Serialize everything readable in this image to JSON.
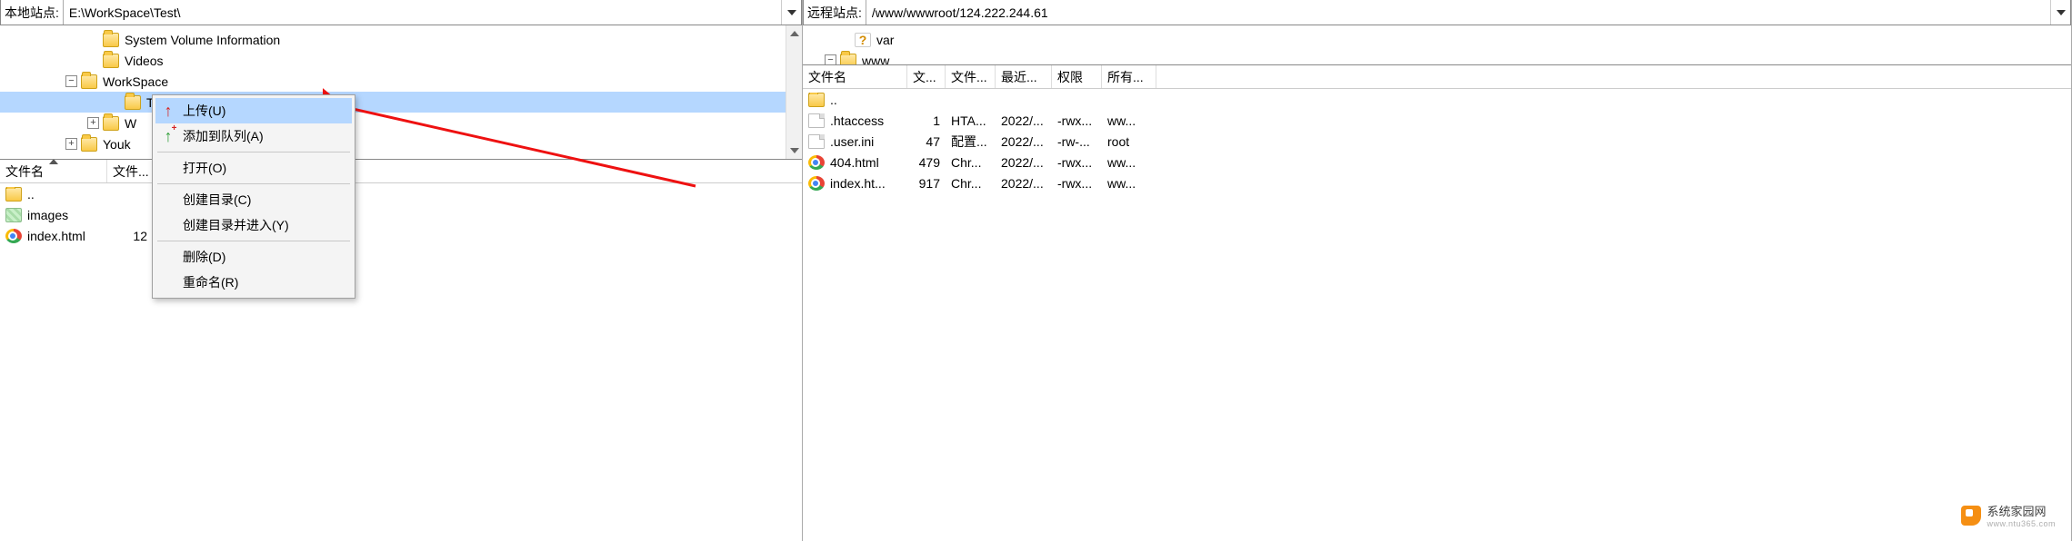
{
  "local": {
    "label": "本地站点:",
    "path": "E:\\WorkSpace\\Test\\",
    "tree": [
      {
        "indent": 96,
        "exp": "",
        "icon": "folder",
        "label": "System Volume Information",
        "sel": false
      },
      {
        "indent": 96,
        "exp": "",
        "icon": "folder",
        "label": "Videos",
        "sel": false
      },
      {
        "indent": 72,
        "exp": "−",
        "icon": "folder",
        "label": "WorkSpace",
        "sel": false
      },
      {
        "indent": 120,
        "exp": "",
        "icon": "folder",
        "label": "Te",
        "sel": true
      },
      {
        "indent": 96,
        "exp": "+",
        "icon": "folder",
        "label": "W",
        "sel": false
      },
      {
        "indent": 72,
        "exp": "+",
        "icon": "folder",
        "label": "Youk",
        "sel": false
      }
    ],
    "cols": {
      "name": "文件名",
      "size": "文件..."
    },
    "rows": [
      {
        "icon": "folder",
        "name": "..",
        "size": ""
      },
      {
        "icon": "sys",
        "name": "images",
        "size": ""
      },
      {
        "icon": "chrome",
        "name": "index.html",
        "size": "12"
      }
    ]
  },
  "remote": {
    "label": "远程站点:",
    "path": "/www/wwwroot/124.222.244.61",
    "tree": [
      {
        "indent": 40,
        "exp": "",
        "icon": "q",
        "label": "var"
      },
      {
        "indent": 24,
        "exp": "−",
        "icon": "folder",
        "label": "www"
      }
    ],
    "cols": {
      "name": "文件名",
      "size": "文...",
      "type": "文件...",
      "mtime": "最近...",
      "perm": "权限",
      "owner": "所有..."
    },
    "rows": [
      {
        "icon": "folder",
        "name": "..",
        "size": "",
        "type": "",
        "mtime": "",
        "perm": "",
        "owner": ""
      },
      {
        "icon": "file",
        "name": ".htaccess",
        "size": "1",
        "type": "HTA...",
        "mtime": "2022/...",
        "perm": "-rwx...",
        "owner": "ww..."
      },
      {
        "icon": "file",
        "name": ".user.ini",
        "size": "47",
        "type": "配置...",
        "mtime": "2022/...",
        "perm": "-rw-...",
        "owner": "root"
      },
      {
        "icon": "chrome",
        "name": "404.html",
        "size": "479",
        "type": "Chr...",
        "mtime": "2022/...",
        "perm": "-rwx...",
        "owner": "ww..."
      },
      {
        "icon": "chrome",
        "name": "index.ht...",
        "size": "917",
        "type": "Chr...",
        "mtime": "2022/...",
        "perm": "-rwx...",
        "owner": "ww..."
      }
    ]
  },
  "ctx": {
    "upload": "上传(U)",
    "queue": "添加到队列(A)",
    "open": "打开(O)",
    "mkdir": "创建目录(C)",
    "mkcd": "创建目录并进入(Y)",
    "del": "删除(D)",
    "ren": "重命名(R)"
  },
  "watermark": {
    "title": "系统家园网",
    "sub": "www.ntu365.com"
  }
}
